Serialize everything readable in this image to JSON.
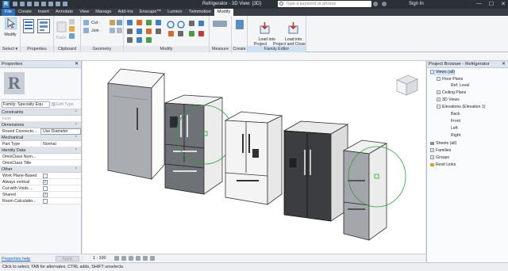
{
  "titlebar": {
    "app_logo": "R",
    "document_title": "Refrigerator - 3D View: {3D}",
    "search_placeholder": "Type a keyword or phrase",
    "sign_in": "Sign In",
    "minimize": "—",
    "maximize": "☐",
    "close": "✕"
  },
  "ribbon_tabs": [
    "File",
    "Create",
    "Insert",
    "Annotate",
    "View",
    "Manage",
    "Add-Ins",
    "Enscape™",
    "Lumion",
    "Twinmotion",
    "Modify"
  ],
  "active_tab": "Modify",
  "ribbon": {
    "select": {
      "label": "Select ▾",
      "modify_label": "Modify"
    },
    "properties_panel": "Properties",
    "clipboard_panel": "Clipboard",
    "paste_label": "Paste",
    "geometry_panel": "Geometry",
    "cut_label": "Cut ·",
    "join_label": "Join ·",
    "modify_panel": "Modify",
    "measure_panel": "Measure",
    "create_panel": "Create",
    "family_editor_panel": "Family Editor",
    "load_into_project": "Load into\nProject",
    "load_into_project_close": "Load into\nProject and Close"
  },
  "properties": {
    "header": "Properties",
    "close": "✕",
    "type_logo": "R",
    "family_selector": "Family: Specialty Equ",
    "edit_type": "Edit Type",
    "sections": [
      {
        "title": "Constraints",
        "rows": [
          {
            "key": "Host",
            "value": "",
            "muted": true
          }
        ]
      },
      {
        "title": "Dimensions",
        "rows": [
          {
            "key": "Round Connecto...",
            "value": "Use Diameter",
            "boxed": true
          }
        ]
      },
      {
        "title": "Mechanical",
        "rows": [
          {
            "key": "Part Type",
            "value": "Normal"
          }
        ]
      },
      {
        "title": "Identity Data",
        "rows": [
          {
            "key": "OmniClass Num...",
            "value": ""
          },
          {
            "key": "OmniClass Title",
            "value": ""
          }
        ]
      },
      {
        "title": "Other",
        "rows": [
          {
            "key": "Work Plane-Based",
            "check": false
          },
          {
            "key": "Always vertical",
            "check": true
          },
          {
            "key": "Cut with Voids ...",
            "check": false
          },
          {
            "key": "Shared",
            "check": true
          },
          {
            "key": "Room Calculatio...",
            "check": false
          }
        ]
      }
    ],
    "help_link": "Properties help",
    "apply": "Apply"
  },
  "viewbar": {
    "scale": "1 : 100"
  },
  "project_browser": {
    "header": "Project Browser - Refrigerator",
    "close": "✕",
    "items": [
      {
        "label": "Views (all)",
        "level": 0,
        "toggle": "−"
      },
      {
        "label": "Floor Plans",
        "level": 1,
        "toggle": "−"
      },
      {
        "label": "Ref. Level",
        "level": 2
      },
      {
        "label": "Ceiling Plans",
        "level": 1,
        "toggle": "+"
      },
      {
        "label": "3D Views",
        "level": 1,
        "toggle": "+"
      },
      {
        "label": "Elevations (Elevation 1)",
        "level": 1,
        "toggle": "−"
      },
      {
        "label": "Back",
        "level": 2
      },
      {
        "label": "Front",
        "level": 2
      },
      {
        "label": "Left",
        "level": 2
      },
      {
        "label": "Right",
        "level": 2
      },
      {
        "label": "Sheets (all)",
        "level": 0,
        "toggle": ""
      },
      {
        "label": "Families",
        "level": 0,
        "toggle": "+"
      },
      {
        "label": "Groups",
        "level": 0,
        "toggle": "+"
      },
      {
        "label": "Revit Links",
        "level": 0,
        "toggle": ""
      }
    ]
  },
  "status_bar": "Click to select, TAB for alternates, CTRL adds, SHIFT unselects.",
  "colors": {
    "file_tab": "#2e6fb5",
    "accent_selection": "#2e9e3a",
    "fridge_dark": "#3b3d40",
    "fridge_steel": "#9a9da1"
  }
}
